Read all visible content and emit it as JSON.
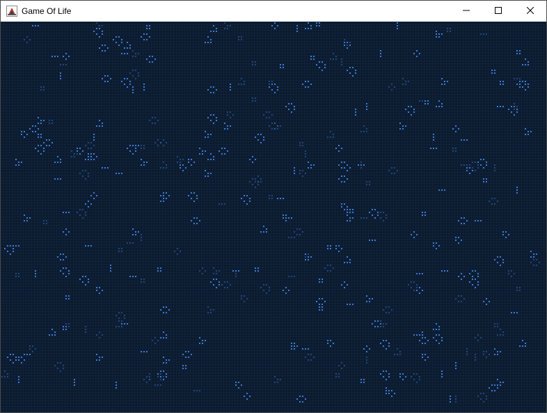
{
  "window": {
    "title": "Game Of Life",
    "icon": "java-app-icon",
    "controls": {
      "minimize_icon": "minimize-icon",
      "maximize_icon": "maximize-icon",
      "close_icon": "close-icon"
    }
  },
  "board": {
    "background_color": "#0b1a2d",
    "grid_color": "#1c3350",
    "live_cell_color": "#3b7bd6"
  }
}
